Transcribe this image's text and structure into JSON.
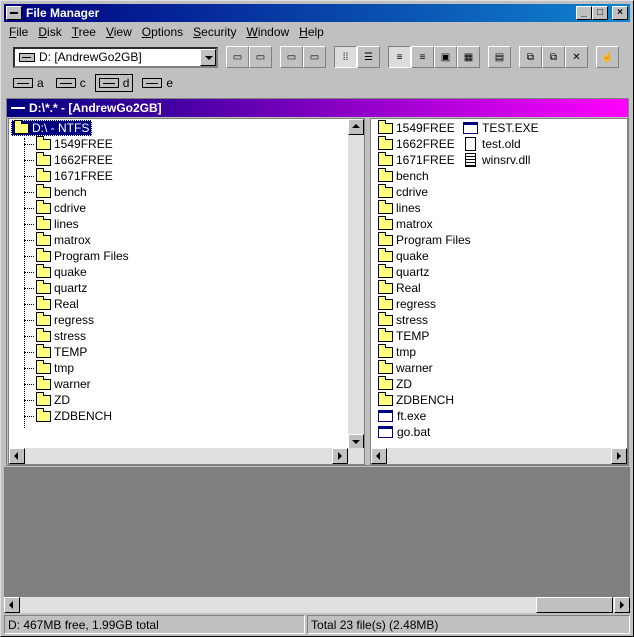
{
  "window": {
    "title": "File Manager"
  },
  "menu": [
    {
      "label": "File",
      "u": "F",
      "rest": "ile"
    },
    {
      "label": "Disk",
      "u": "D",
      "rest": "isk"
    },
    {
      "label": "Tree",
      "u": "T",
      "rest": "ree"
    },
    {
      "label": "View",
      "u": "V",
      "rest": "iew"
    },
    {
      "label": "Options",
      "u": "O",
      "rest": "ptions"
    },
    {
      "label": "Security",
      "u": "S",
      "rest": "ecurity"
    },
    {
      "label": "Window",
      "u": "W",
      "rest": "indow"
    },
    {
      "label": "Help",
      "u": "H",
      "rest": "elp"
    }
  ],
  "toolbar": {
    "drive_select": "D: [AndrewGo2GB]"
  },
  "drives": [
    "a",
    "c",
    "d",
    "e"
  ],
  "child": {
    "title": "D:\\*.* - [AndrewGo2GB]",
    "tree_root": "D:\\ - NTFS",
    "tree_folders": [
      "1549FREE",
      "1662FREE",
      "1671FREE",
      "bench",
      "cdrive",
      "lines",
      "matrox",
      "Program Files",
      "quake",
      "quartz",
      "Real",
      "regress",
      "stress",
      "TEMP",
      "tmp",
      "warner",
      "ZD",
      "ZDBENCH"
    ],
    "files_col1": [
      {
        "name": "1549FREE",
        "type": "folder"
      },
      {
        "name": "1662FREE",
        "type": "folder"
      },
      {
        "name": "1671FREE",
        "type": "folder"
      },
      {
        "name": "bench",
        "type": "folder"
      },
      {
        "name": "cdrive",
        "type": "folder"
      },
      {
        "name": "lines",
        "type": "folder"
      },
      {
        "name": "matrox",
        "type": "folder"
      },
      {
        "name": "Program Files",
        "type": "folder"
      },
      {
        "name": "quake",
        "type": "folder"
      },
      {
        "name": "quartz",
        "type": "folder"
      },
      {
        "name": "Real",
        "type": "folder"
      },
      {
        "name": "regress",
        "type": "folder"
      },
      {
        "name": "stress",
        "type": "folder"
      },
      {
        "name": "TEMP",
        "type": "folder"
      },
      {
        "name": "tmp",
        "type": "folder"
      },
      {
        "name": "warner",
        "type": "folder"
      },
      {
        "name": "ZD",
        "type": "folder"
      },
      {
        "name": "ZDBENCH",
        "type": "folder"
      },
      {
        "name": "ft.exe",
        "type": "exe"
      },
      {
        "name": "go.bat",
        "type": "exe"
      }
    ],
    "files_col2": [
      {
        "name": "TEST.EXE",
        "type": "exe"
      },
      {
        "name": "test.old",
        "type": "doc"
      },
      {
        "name": "winsrv.dll",
        "type": "dll"
      }
    ]
  },
  "status": {
    "disk": "D: 467MB free,  1.99GB total",
    "files": "Total 23 file(s) (2.48MB)"
  }
}
